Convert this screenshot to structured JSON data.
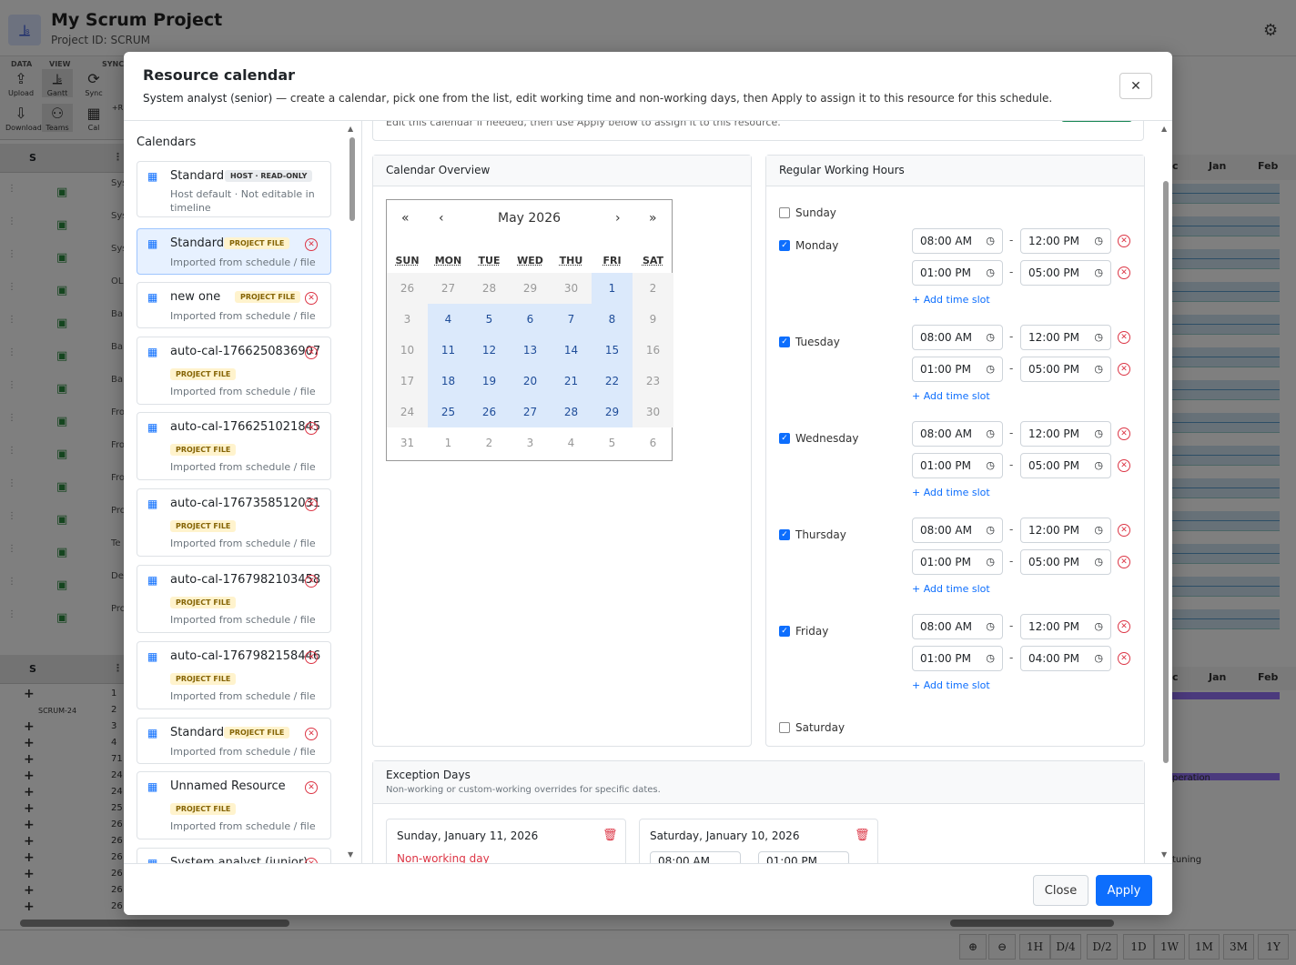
{
  "app": {
    "title": "My Scrum Project",
    "project_id": "Project ID: SCRUM"
  },
  "ribbon": {
    "groups": [
      "DATA",
      "VIEW",
      "SYNC"
    ],
    "buttons": [
      {
        "label": "Upload",
        "icon": "upload-icon"
      },
      {
        "label": "Gantt",
        "icon": "gantt-icon"
      },
      {
        "label": "Sync",
        "icon": "sync-icon"
      },
      {
        "label": "Download",
        "icon": "download-icon"
      },
      {
        "label": "Teams",
        "icon": "teams-icon"
      },
      {
        "label": "Cal",
        "icon": "calendar-icon"
      },
      {
        "label": "+R"
      }
    ]
  },
  "background": {
    "grid_col": "S",
    "rows_top": [
      "Sys",
      "Sys",
      "Sys",
      "OL",
      "Ba",
      "Ba",
      "Ba",
      "Fro",
      "Fro",
      "Fro",
      "Pro",
      "Te",
      "De",
      "Pro"
    ],
    "rows_bottom_nums": [
      "1",
      "2",
      "3",
      "4",
      "71",
      "24",
      "24",
      "25",
      "26",
      "26",
      "26",
      "26",
      "26",
      "26"
    ],
    "row_bottom_label": "SCRUM-24",
    "timeline_months": [
      "Jan",
      "Feb"
    ],
    "timeline_partial": "c",
    "timeline_text": [
      "peration",
      "tuning"
    ],
    "zoom_buttons": [
      "1H",
      "D/4",
      "D/2",
      "1D",
      "1W",
      "1M",
      "3M",
      "1Y"
    ]
  },
  "modal": {
    "title": "Resource calendar",
    "resource": "System analyst (senior)",
    "description": " — create a calendar, pick one from the list, edit working time and non-working days, then Apply to assign it to this resource for this schedule.",
    "close_label": "Close",
    "apply_label": "Apply",
    "top_note": "Edit this calendar if needed, then use Apply below to assign it to this resource."
  },
  "calendars": {
    "title": "Calendars",
    "items": [
      {
        "name": "Standard",
        "badge": "HOST · READ-ONLY",
        "sub": "Host default · Not editable in timeline"
      },
      {
        "name": "Standard",
        "badge": "PROJECT FILE",
        "sub": "Imported from schedule / file"
      },
      {
        "name": "new one",
        "badge": "PROJECT FILE",
        "sub": "Imported from schedule / file"
      },
      {
        "name": "auto-cal-1766250836907",
        "badge": "PROJECT FILE",
        "sub": "Imported from schedule / file"
      },
      {
        "name": "auto-cal-1766251021845",
        "badge": "PROJECT FILE",
        "sub": "Imported from schedule / file"
      },
      {
        "name": "auto-cal-1767358512031",
        "badge": "PROJECT FILE",
        "sub": "Imported from schedule / file"
      },
      {
        "name": "auto-cal-1767982103458",
        "badge": "PROJECT FILE",
        "sub": "Imported from schedule / file"
      },
      {
        "name": "auto-cal-1767982158446",
        "badge": "PROJECT FILE",
        "sub": "Imported from schedule / file"
      },
      {
        "name": "Standard",
        "badge": "PROJECT FILE",
        "sub": "Imported from schedule / file"
      },
      {
        "name": "Unnamed Resource",
        "badge": "PROJECT FILE",
        "sub": "Imported from schedule / file"
      },
      {
        "name": "System analyst (junior)"
      }
    ]
  },
  "overview": {
    "title": "Calendar Overview",
    "month": "May 2026",
    "nav": [
      "«",
      "‹",
      "›",
      "»"
    ],
    "weekdays": [
      "SUN",
      "MON",
      "TUE",
      "WED",
      "THU",
      "FRI",
      "SAT"
    ],
    "weeks": [
      [
        "26",
        "27",
        "28",
        "29",
        "30",
        "1",
        "2"
      ],
      [
        "3",
        "4",
        "5",
        "6",
        "7",
        "8",
        "9"
      ],
      [
        "10",
        "11",
        "12",
        "13",
        "14",
        "15",
        "16"
      ],
      [
        "17",
        "18",
        "19",
        "20",
        "21",
        "22",
        "23"
      ],
      [
        "24",
        "25",
        "26",
        "27",
        "28",
        "29",
        "30"
      ],
      [
        "31",
        "1",
        "2",
        "3",
        "4",
        "5",
        "6"
      ]
    ]
  },
  "working_hours": {
    "title": "Regular Working Hours",
    "add_slot_label": "Add time slot",
    "days": [
      {
        "name": "Sunday",
        "checked": false,
        "slots": []
      },
      {
        "name": "Monday",
        "checked": true,
        "slots": [
          [
            "08:00 AM",
            "12:00 PM"
          ],
          [
            "01:00 PM",
            "05:00 PM"
          ]
        ]
      },
      {
        "name": "Tuesday",
        "checked": true,
        "slots": [
          [
            "08:00 AM",
            "12:00 PM"
          ],
          [
            "01:00 PM",
            "05:00 PM"
          ]
        ]
      },
      {
        "name": "Wednesday",
        "checked": true,
        "slots": [
          [
            "08:00 AM",
            "12:00 PM"
          ],
          [
            "01:00 PM",
            "05:00 PM"
          ]
        ]
      },
      {
        "name": "Thursday",
        "checked": true,
        "slots": [
          [
            "08:00 AM",
            "12:00 PM"
          ],
          [
            "01:00 PM",
            "05:00 PM"
          ]
        ]
      },
      {
        "name": "Friday",
        "checked": true,
        "slots": [
          [
            "08:00 AM",
            "12:00 PM"
          ],
          [
            "01:00 PM",
            "04:00 PM"
          ]
        ]
      },
      {
        "name": "Saturday",
        "checked": false,
        "slots": []
      }
    ]
  },
  "exceptions": {
    "title": "Exception Days",
    "subtitle": "Non-working or custom-working overrides for specific dates.",
    "items": [
      {
        "date": "Sunday, January 11, 2026",
        "type": "Non-working day"
      },
      {
        "date": "Saturday, January 10, 2026",
        "slot": [
          "08:00 AM",
          "01:00 PM"
        ]
      }
    ]
  }
}
